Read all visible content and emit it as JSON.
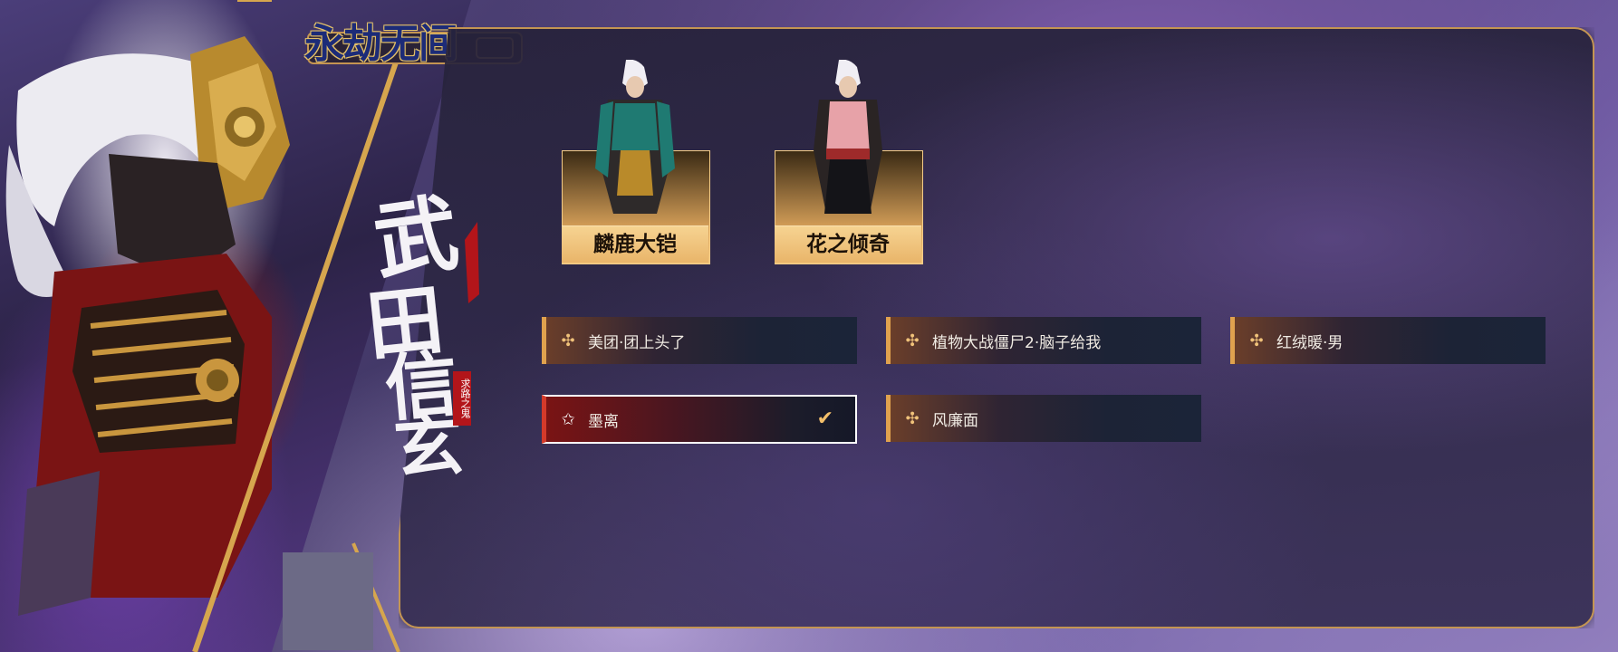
{
  "logo": {
    "text": "永劫无间"
  },
  "banner": {
    "calligraphy": "武田信玄",
    "seal": "求路之鬼"
  },
  "outfits": [
    {
      "label": "麟鹿大铠",
      "accent": "#1f7a72"
    },
    {
      "label": "花之倾奇",
      "accent": "#e7a2a8"
    }
  ],
  "options": [
    {
      "label": "美团·团上头了",
      "selected": false,
      "icon": "sparkle-icon"
    },
    {
      "label": "植物大战僵尸2·脑子给我",
      "selected": false,
      "icon": "sparkle-icon"
    },
    {
      "label": "红绒暖·男",
      "selected": false,
      "icon": "sparkle-icon"
    },
    {
      "label": "墨离",
      "selected": true,
      "icon": "sparkle-icon"
    },
    {
      "label": "风廉面",
      "selected": false,
      "icon": "sparkle-icon"
    }
  ],
  "colors": {
    "gold": "#c49552",
    "selected_border": "#ffffff",
    "selected_accent": "#d43a2a"
  }
}
